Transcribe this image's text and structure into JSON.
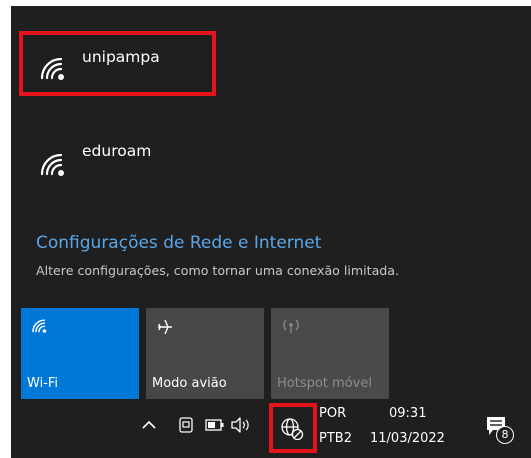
{
  "networks": [
    {
      "ssid": "unipampa",
      "icon": "wifi-icon"
    },
    {
      "ssid": "eduroam",
      "icon": "wifi-icon"
    }
  ],
  "settings": {
    "link": "Configurações de Rede e Internet",
    "description": "Altere configurações, como tornar uma conexão limitada."
  },
  "quick_actions": [
    {
      "label": "Wi-Fi",
      "icon": "wifi-icon",
      "active": true
    },
    {
      "label": "Modo avião",
      "icon": "airplane-icon",
      "active": false
    },
    {
      "label": "Hotspot móvel",
      "icon": "hotspot-icon",
      "active": false,
      "disabled": true
    }
  ],
  "taskbar": {
    "lang_top": "POR",
    "lang_bottom": "PTB2",
    "time": "09:31",
    "date": "11/03/2022",
    "notification_count": "8"
  },
  "colors": {
    "accent": "#0078d7",
    "link": "#5aa7e8",
    "highlight": "#e5141c",
    "panel": "#1f1f1f"
  }
}
